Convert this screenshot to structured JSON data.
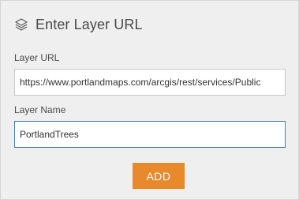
{
  "header": {
    "icon": "layers-icon",
    "title": "Enter Layer URL"
  },
  "form": {
    "url_label": "Layer URL",
    "url_value": "https://www.portlandmaps.com/arcgis/rest/services/Public",
    "name_label": "Layer Name",
    "name_value": "PortlandTrees",
    "add_label": "ADD"
  },
  "colors": {
    "panel_background": "#efefef",
    "accent_button": "#e8892b",
    "focused_border": "#4a7fb0"
  }
}
